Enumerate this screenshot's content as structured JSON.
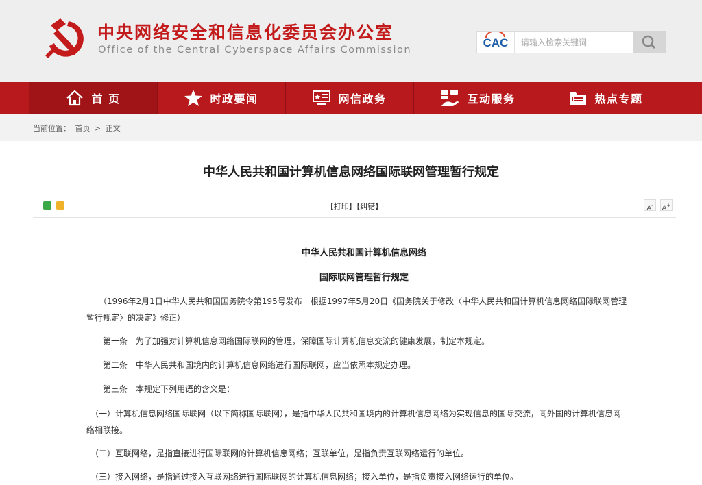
{
  "header": {
    "title_cn": "中央网络安全和信息化委员会办公室",
    "title_en": "Office of the Central Cyberspace Affairs Commission",
    "emblem_icon": "hammer-sickle-icon",
    "search": {
      "logo_text": "CAC",
      "placeholder": "请输入检索关键词",
      "button_icon": "search-icon"
    }
  },
  "nav": {
    "items": [
      {
        "label": "首 页",
        "icon": "home-icon"
      },
      {
        "label": "时政要闻",
        "icon": "star-icon"
      },
      {
        "label": "网信政务",
        "icon": "gov-board-icon"
      },
      {
        "label": "互动服务",
        "icon": "interaction-icon"
      },
      {
        "label": "热点专题",
        "icon": "folder-icon"
      }
    ]
  },
  "breadcrumb": {
    "prefix": "当前位置：",
    "home": "首页",
    "sep": ">",
    "current": "正文"
  },
  "article": {
    "title": "中华人民共和国计算机信息网络国际联网管理暂行规定",
    "tools": {
      "print": "【打印】",
      "correct": "【纠错】",
      "font_small": "A",
      "font_large": "A"
    },
    "heading1": "中华人民共和国计算机信息网络",
    "heading2": "国际联网管理暂行规定",
    "paragraphs": [
      "　　（1996年2月1日中华人民共和国国务院令第195号发布　根据1997年5月20日《国务院关于修改〈中华人民共和国计算机信息网络国际联网管理暂行规定〉的决定》修正）",
      "　　第一条　为了加强对计算机信息网络国际联网的管理，保障国际计算机信息交流的健康发展，制定本规定。",
      "　　第二条　中华人民共和国境内的计算机信息网络进行国际联网，应当依照本规定办理。",
      "　　第三条　本规定下列用语的含义是：",
      "　（一）计算机信息网络国际联网（以下简称国际联网），是指中华人民共和国境内的计算机信息网络为实现信息的国际交流，同外国的计算机信息网络相联接。",
      "　（二）互联网络，是指直接进行国际联网的计算机信息网络；互联单位，是指负责互联网络运行的单位。",
      "　（三）接入网络，是指通过接入互联网络进行国际联网的计算机信息网络；接入单位，是指负责接入网络运行的单位。"
    ]
  },
  "colors": {
    "brand_red": "#b8191d",
    "header_bg": "#eeeeee",
    "title_red": "#c31b1b"
  }
}
